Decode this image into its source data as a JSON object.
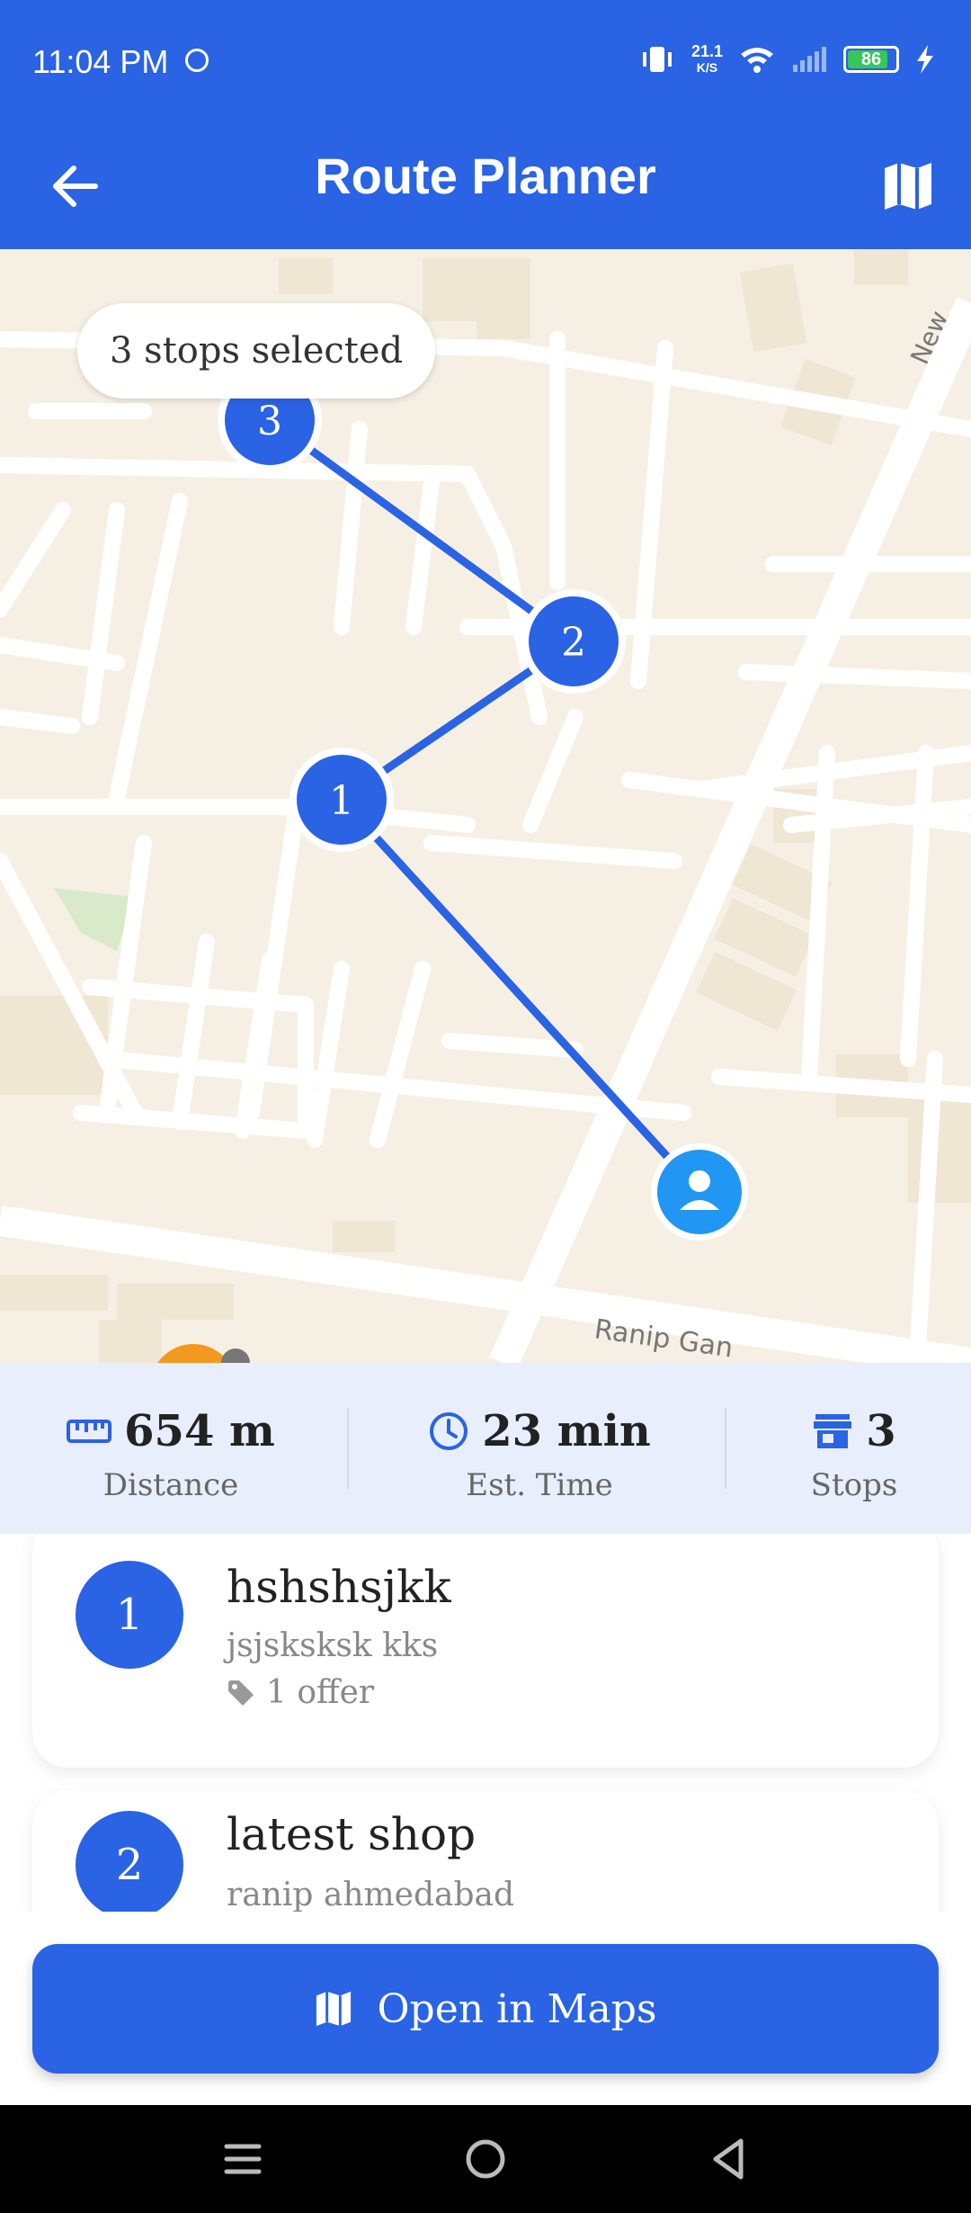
{
  "status_bar": {
    "time": "11:04 PM",
    "net_speed_value": "21.1",
    "net_speed_unit": "K/S",
    "battery_level": "86",
    "battery_fraction": 0.86
  },
  "app_bar": {
    "title": "Route Planner",
    "back_icon": "arrow-left-icon",
    "map_icon": "map-icon"
  },
  "map": {
    "selection_text": "3 stops selected",
    "markers": [
      "1",
      "2",
      "3"
    ],
    "street_label": "Ranip Gan",
    "street_label_2": "New"
  },
  "stats": {
    "distance_value": "654 m",
    "distance_label": "Distance",
    "time_value": "23 min",
    "time_label": "Est. Time",
    "stops_value": "3",
    "stops_label": "Stops"
  },
  "stops": [
    {
      "number": "1",
      "name": "hshshsjkk",
      "address": "jsjsksksk kks",
      "offers": "1 offer"
    },
    {
      "number": "2",
      "name": "latest shop",
      "address": "ranip ahmedabad"
    }
  ],
  "open_maps_label": "Open in Maps",
  "colors": {
    "primary": "#2A63E3",
    "map_bg": "#F6F0E4",
    "stats_bg": "#E8EEFB",
    "user_marker": "#2196F3"
  }
}
